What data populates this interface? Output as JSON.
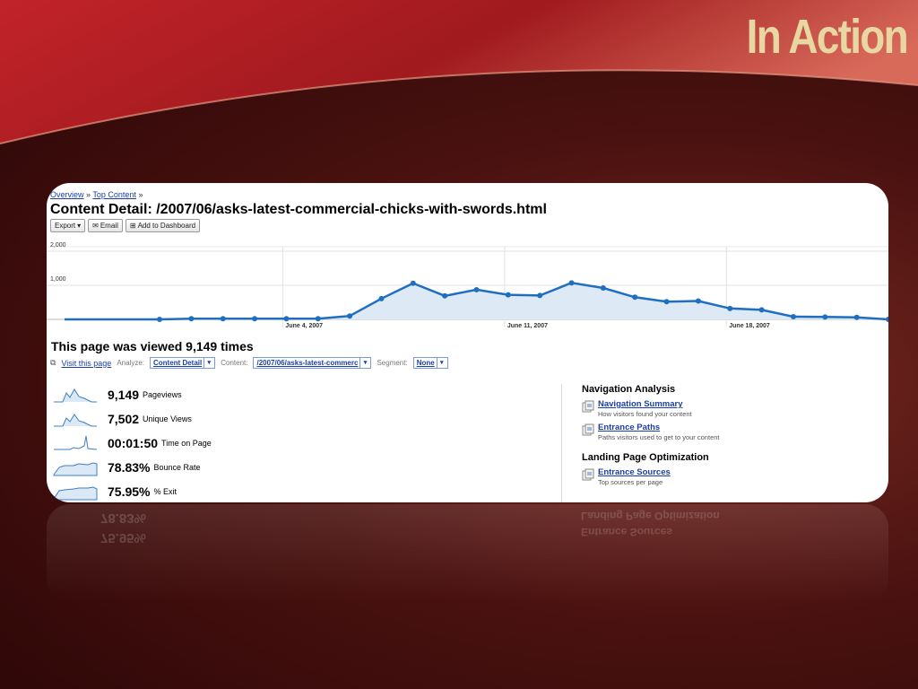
{
  "slide": {
    "title": "In Action"
  },
  "breadcrumb": {
    "overview": "Overview",
    "sep1": "»",
    "top_content": "Top Content",
    "sep2": "»"
  },
  "page_title": "Content Detail: /2007/06/asks-latest-commercial-chicks-with-swords.html",
  "toolbar": {
    "export": "Export",
    "email": "Email",
    "dashboard": "Add to Dashboard"
  },
  "chart_data": {
    "type": "area",
    "title": "",
    "xlabel": "",
    "ylabel": "",
    "y_ticks": [
      "2,000",
      "1,000"
    ],
    "ylim": [
      0,
      2500
    ],
    "x_ticks": [
      "June 4, 2007",
      "June 11, 2007",
      "June 18, 2007"
    ],
    "x_tick_index": [
      7,
      14,
      21
    ],
    "series": [
      {
        "values": [
          null,
          null,
          null,
          0,
          20,
          20,
          20,
          20,
          20,
          100,
          610,
          1060,
          690,
          870,
          720,
          700,
          1070,
          920,
          650,
          520,
          540,
          320,
          280,
          80,
          70,
          60,
          0
        ],
        "marker_from": 3
      }
    ],
    "color": "#1f6fc0",
    "fill": "#dde9f5",
    "grid": true
  },
  "summary": {
    "viewed": "This page was viewed 9,149 times"
  },
  "filters": {
    "visit_link": "Visit this page",
    "analyze_label": "Analyze:",
    "analyze_value": "Content Detail",
    "content_label": "Content:",
    "content_value": "/2007/06/asks-latest-commerc",
    "segment_label": "Segment:",
    "segment_value": "None"
  },
  "metrics": [
    {
      "value": "9,149",
      "label": "Pageviews"
    },
    {
      "value": "7,502",
      "label": "Unique Views"
    },
    {
      "value": "00:01:50",
      "label": "Time on Page"
    },
    {
      "value": "78.83%",
      "label": "Bounce Rate"
    },
    {
      "value": "75.95%",
      "label": "% Exit"
    }
  ],
  "navigation_analysis": {
    "heading": "Navigation Analysis",
    "links": [
      {
        "title": "Navigation Summary",
        "desc": "How visitors found your content"
      },
      {
        "title": "Entrance Paths",
        "desc": "Paths visitors used to get to your content"
      }
    ]
  },
  "landing_page": {
    "heading": "Landing Page Optimization",
    "links": [
      {
        "title": "Entrance Sources",
        "desc": "Top sources per page"
      }
    ]
  },
  "colors": {
    "accent": "#1a3fa8",
    "line": "#1f6fc0",
    "title_gold": "#e8d6a3"
  }
}
